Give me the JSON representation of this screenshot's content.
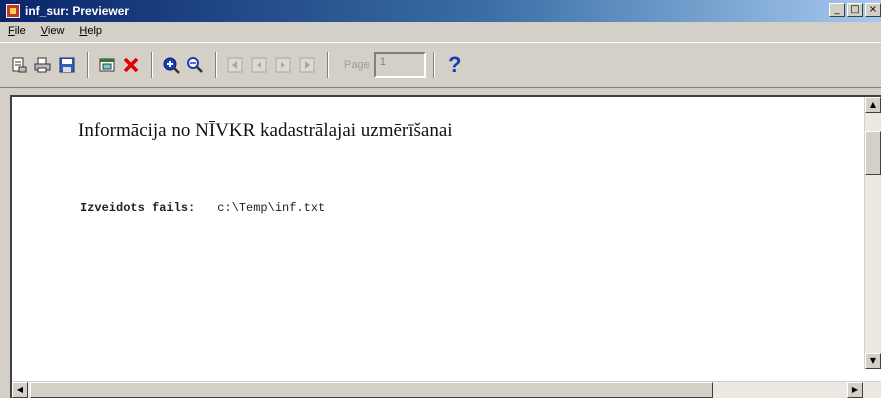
{
  "window": {
    "title": "inf_sur: Previewer",
    "buttons": {
      "minimize": "_",
      "maximize": "□",
      "close": "×"
    }
  },
  "menu": {
    "items": [
      {
        "label": "File"
      },
      {
        "label": "View"
      },
      {
        "label": "Help"
      }
    ]
  },
  "toolbar": {
    "page_label": "Page",
    "page_value": "1",
    "help_symbol": "?",
    "icons": [
      "print-setup-icon",
      "print-icon",
      "save-icon",
      "export-icon",
      "close-preview-icon",
      "zoom-in-icon",
      "zoom-out-icon",
      "first-page-icon",
      "previous-page-icon",
      "next-page-icon",
      "last-page-icon",
      "help-icon"
    ],
    "colors": {
      "close_x": "#e00000",
      "zoom": "#1c3bb8",
      "help": "#1c3bb8"
    }
  },
  "document": {
    "title": "Informācija no NĪVKR kadastrālajai uzmērīšanai",
    "file_label": "Izveidots fails:",
    "file_value": "c:\\Temp\\inf.txt"
  },
  "scrollbars": {
    "up": "▲",
    "down": "▼",
    "left": "◀",
    "right": "▶"
  }
}
